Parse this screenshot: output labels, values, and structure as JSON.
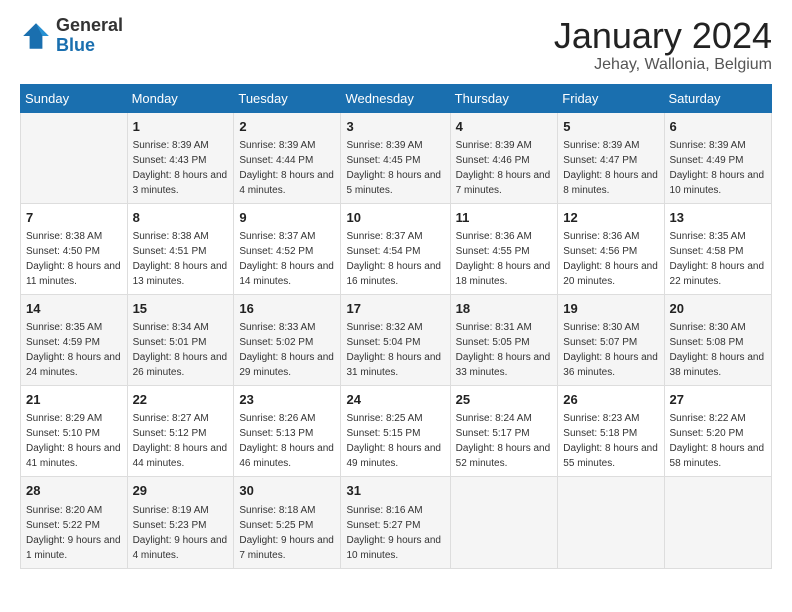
{
  "logo": {
    "general": "General",
    "blue": "Blue"
  },
  "title": "January 2024",
  "subtitle": "Jehay, Wallonia, Belgium",
  "days_header": [
    "Sunday",
    "Monday",
    "Tuesday",
    "Wednesday",
    "Thursday",
    "Friday",
    "Saturday"
  ],
  "weeks": [
    [
      {
        "day": "",
        "sunrise": "",
        "sunset": "",
        "daylight": ""
      },
      {
        "day": "1",
        "sunrise": "Sunrise: 8:39 AM",
        "sunset": "Sunset: 4:43 PM",
        "daylight": "Daylight: 8 hours and 3 minutes."
      },
      {
        "day": "2",
        "sunrise": "Sunrise: 8:39 AM",
        "sunset": "Sunset: 4:44 PM",
        "daylight": "Daylight: 8 hours and 4 minutes."
      },
      {
        "day": "3",
        "sunrise": "Sunrise: 8:39 AM",
        "sunset": "Sunset: 4:45 PM",
        "daylight": "Daylight: 8 hours and 5 minutes."
      },
      {
        "day": "4",
        "sunrise": "Sunrise: 8:39 AM",
        "sunset": "Sunset: 4:46 PM",
        "daylight": "Daylight: 8 hours and 7 minutes."
      },
      {
        "day": "5",
        "sunrise": "Sunrise: 8:39 AM",
        "sunset": "Sunset: 4:47 PM",
        "daylight": "Daylight: 8 hours and 8 minutes."
      },
      {
        "day": "6",
        "sunrise": "Sunrise: 8:39 AM",
        "sunset": "Sunset: 4:49 PM",
        "daylight": "Daylight: 8 hours and 10 minutes."
      }
    ],
    [
      {
        "day": "7",
        "sunrise": "Sunrise: 8:38 AM",
        "sunset": "Sunset: 4:50 PM",
        "daylight": "Daylight: 8 hours and 11 minutes."
      },
      {
        "day": "8",
        "sunrise": "Sunrise: 8:38 AM",
        "sunset": "Sunset: 4:51 PM",
        "daylight": "Daylight: 8 hours and 13 minutes."
      },
      {
        "day": "9",
        "sunrise": "Sunrise: 8:37 AM",
        "sunset": "Sunset: 4:52 PM",
        "daylight": "Daylight: 8 hours and 14 minutes."
      },
      {
        "day": "10",
        "sunrise": "Sunrise: 8:37 AM",
        "sunset": "Sunset: 4:54 PM",
        "daylight": "Daylight: 8 hours and 16 minutes."
      },
      {
        "day": "11",
        "sunrise": "Sunrise: 8:36 AM",
        "sunset": "Sunset: 4:55 PM",
        "daylight": "Daylight: 8 hours and 18 minutes."
      },
      {
        "day": "12",
        "sunrise": "Sunrise: 8:36 AM",
        "sunset": "Sunset: 4:56 PM",
        "daylight": "Daylight: 8 hours and 20 minutes."
      },
      {
        "day": "13",
        "sunrise": "Sunrise: 8:35 AM",
        "sunset": "Sunset: 4:58 PM",
        "daylight": "Daylight: 8 hours and 22 minutes."
      }
    ],
    [
      {
        "day": "14",
        "sunrise": "Sunrise: 8:35 AM",
        "sunset": "Sunset: 4:59 PM",
        "daylight": "Daylight: 8 hours and 24 minutes."
      },
      {
        "day": "15",
        "sunrise": "Sunrise: 8:34 AM",
        "sunset": "Sunset: 5:01 PM",
        "daylight": "Daylight: 8 hours and 26 minutes."
      },
      {
        "day": "16",
        "sunrise": "Sunrise: 8:33 AM",
        "sunset": "Sunset: 5:02 PM",
        "daylight": "Daylight: 8 hours and 29 minutes."
      },
      {
        "day": "17",
        "sunrise": "Sunrise: 8:32 AM",
        "sunset": "Sunset: 5:04 PM",
        "daylight": "Daylight: 8 hours and 31 minutes."
      },
      {
        "day": "18",
        "sunrise": "Sunrise: 8:31 AM",
        "sunset": "Sunset: 5:05 PM",
        "daylight": "Daylight: 8 hours and 33 minutes."
      },
      {
        "day": "19",
        "sunrise": "Sunrise: 8:30 AM",
        "sunset": "Sunset: 5:07 PM",
        "daylight": "Daylight: 8 hours and 36 minutes."
      },
      {
        "day": "20",
        "sunrise": "Sunrise: 8:30 AM",
        "sunset": "Sunset: 5:08 PM",
        "daylight": "Daylight: 8 hours and 38 minutes."
      }
    ],
    [
      {
        "day": "21",
        "sunrise": "Sunrise: 8:29 AM",
        "sunset": "Sunset: 5:10 PM",
        "daylight": "Daylight: 8 hours and 41 minutes."
      },
      {
        "day": "22",
        "sunrise": "Sunrise: 8:27 AM",
        "sunset": "Sunset: 5:12 PM",
        "daylight": "Daylight: 8 hours and 44 minutes."
      },
      {
        "day": "23",
        "sunrise": "Sunrise: 8:26 AM",
        "sunset": "Sunset: 5:13 PM",
        "daylight": "Daylight: 8 hours and 46 minutes."
      },
      {
        "day": "24",
        "sunrise": "Sunrise: 8:25 AM",
        "sunset": "Sunset: 5:15 PM",
        "daylight": "Daylight: 8 hours and 49 minutes."
      },
      {
        "day": "25",
        "sunrise": "Sunrise: 8:24 AM",
        "sunset": "Sunset: 5:17 PM",
        "daylight": "Daylight: 8 hours and 52 minutes."
      },
      {
        "day": "26",
        "sunrise": "Sunrise: 8:23 AM",
        "sunset": "Sunset: 5:18 PM",
        "daylight": "Daylight: 8 hours and 55 minutes."
      },
      {
        "day": "27",
        "sunrise": "Sunrise: 8:22 AM",
        "sunset": "Sunset: 5:20 PM",
        "daylight": "Daylight: 8 hours and 58 minutes."
      }
    ],
    [
      {
        "day": "28",
        "sunrise": "Sunrise: 8:20 AM",
        "sunset": "Sunset: 5:22 PM",
        "daylight": "Daylight: 9 hours and 1 minute."
      },
      {
        "day": "29",
        "sunrise": "Sunrise: 8:19 AM",
        "sunset": "Sunset: 5:23 PM",
        "daylight": "Daylight: 9 hours and 4 minutes."
      },
      {
        "day": "30",
        "sunrise": "Sunrise: 8:18 AM",
        "sunset": "Sunset: 5:25 PM",
        "daylight": "Daylight: 9 hours and 7 minutes."
      },
      {
        "day": "31",
        "sunrise": "Sunrise: 8:16 AM",
        "sunset": "Sunset: 5:27 PM",
        "daylight": "Daylight: 9 hours and 10 minutes."
      },
      {
        "day": "",
        "sunrise": "",
        "sunset": "",
        "daylight": ""
      },
      {
        "day": "",
        "sunrise": "",
        "sunset": "",
        "daylight": ""
      },
      {
        "day": "",
        "sunrise": "",
        "sunset": "",
        "daylight": ""
      }
    ]
  ]
}
